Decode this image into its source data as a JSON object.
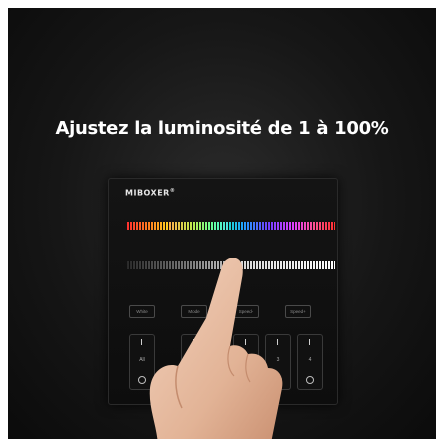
{
  "headline": "Ajustez la luminosité de 1 à 100%",
  "panel": {
    "brand": "MIBOXER",
    "brand_mark": "®",
    "buttons": [
      {
        "label": "White"
      },
      {
        "label": "Mode"
      },
      {
        "label": "Speed-"
      },
      {
        "label": "Speed+"
      }
    ],
    "zones": [
      {
        "number": "I",
        "sub": "All"
      },
      {
        "number": "I",
        "sub": "1"
      },
      {
        "number": "I",
        "sub": "2"
      },
      {
        "number": "I",
        "sub": "3"
      },
      {
        "number": "I",
        "sub": "4"
      }
    ]
  },
  "colors": {
    "background": "#0b0b0b",
    "text": "#ffffff",
    "panel": "#111111"
  },
  "icons": [
    "rgb-slider-icon",
    "brightness-slider-icon",
    "hand-pointer-icon"
  ]
}
